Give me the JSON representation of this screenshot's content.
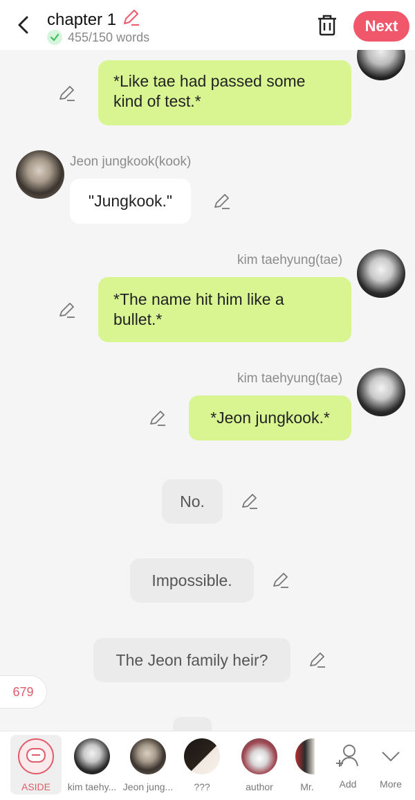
{
  "header": {
    "title": "chapter 1",
    "word_count": "455/150 words",
    "next_label": "Next"
  },
  "messages": [
    {
      "text": "*Like tae had passed some kind of test.*"
    },
    {
      "sender": "Jeon jungkook(kook)",
      "text": "\"Jungkook.\""
    },
    {
      "sender": "kim taehyung(tae)",
      "text": "*The name hit him like a bullet.*"
    },
    {
      "sender": "kim taehyung(tae)",
      "text": "*Jeon jungkook.*"
    },
    {
      "text": "No."
    },
    {
      "text": "Impossible."
    },
    {
      "text": "The Jeon family heir?"
    }
  ],
  "counter": "679",
  "bottom_bar": {
    "aside": "ASIDE",
    "characters": [
      "kim taehy...",
      "Jeon jung...",
      "???",
      "author",
      "Mr."
    ],
    "add": "Add",
    "more": "More"
  },
  "colors": {
    "accent": "#f0576a",
    "green_bubble": "#d8f592",
    "narration_bubble": "#ebebeb"
  }
}
